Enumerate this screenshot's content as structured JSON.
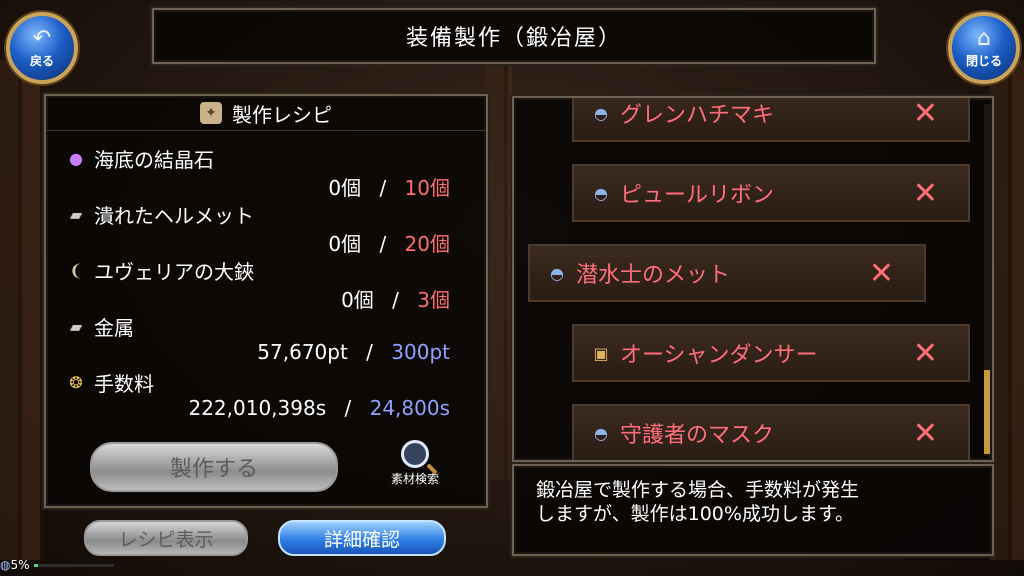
{
  "title": "装備製作（鍛冶屋）",
  "nav": {
    "back_label": "戻る",
    "back_icon": "back-arrow-icon",
    "close_label": "閉じる",
    "close_icon": "home-icon"
  },
  "recipe": {
    "header": "製作レシピ",
    "materials": [
      {
        "name": "海底の結晶石",
        "icon": "crystal-icon",
        "have": "0個",
        "sep": "/",
        "need": "10個",
        "need_color": "red"
      },
      {
        "name": "潰れたヘルメット",
        "icon": "ingot-icon",
        "have": "0個",
        "sep": "/",
        "need": "20個",
        "need_color": "red"
      },
      {
        "name": "ユヴェリアの大鋏",
        "icon": "claw-icon",
        "have": "0個",
        "sep": "/",
        "need": "3個",
        "need_color": "red"
      },
      {
        "name": "金属",
        "icon": "ingot-icon",
        "have": "57,670pt",
        "sep": "/",
        "need": "300pt",
        "need_color": "blue"
      },
      {
        "name": "手数料",
        "icon": "coins-icon",
        "have": "222,010,398s",
        "sep": "/",
        "need": "24,800s",
        "need_color": "blue"
      }
    ],
    "make_button": "製作する",
    "search_label": "素材検索"
  },
  "buttons": {
    "show_recipe": "レシピ表示",
    "details": "詳細確認"
  },
  "list": {
    "items": [
      {
        "name": "グレンハチマキ",
        "icon": "helmet-icon",
        "mark": "✕"
      },
      {
        "name": "ピュールリボン",
        "icon": "helmet-icon",
        "mark": "✕"
      },
      {
        "name": "潜水士のメット",
        "icon": "helmet-icon",
        "mark": "✕"
      },
      {
        "name": "オーシャンダンサー",
        "icon": "armor-icon",
        "mark": "✕"
      },
      {
        "name": "守護者のマスク",
        "icon": "helmet-icon",
        "mark": "✕"
      }
    ]
  },
  "info": {
    "line1": "鍛冶屋で製作する場合、手数料が発生",
    "line2": "しますが、製作は100%成功します。"
  },
  "status": {
    "percent_label": "5%",
    "progress": 0.05
  }
}
